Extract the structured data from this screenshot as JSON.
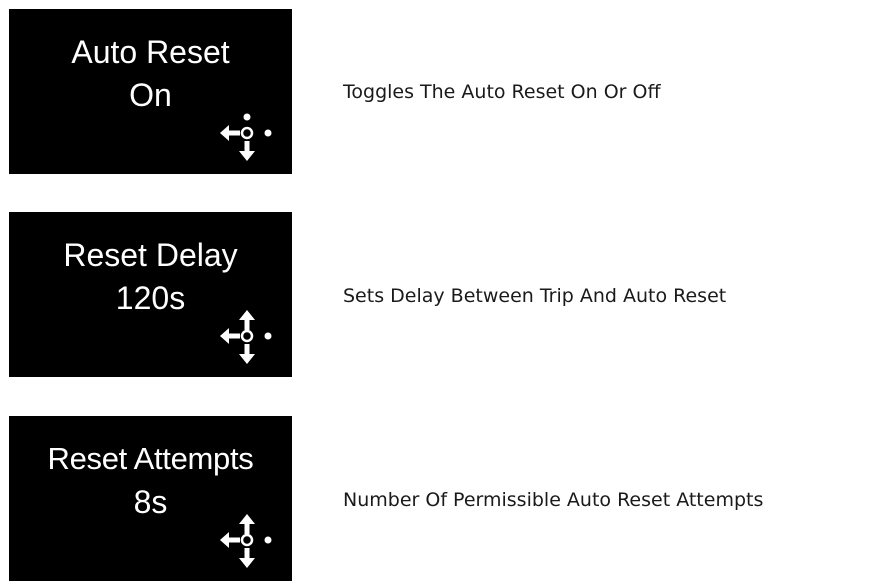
{
  "settings": [
    {
      "title": "Auto Reset",
      "value": "On",
      "description": "Toggles The Auto Reset On Or Off",
      "nav_icon": "nav-left-right-down-icon"
    },
    {
      "title": "Reset Delay",
      "value": "120s",
      "description": "Sets Delay Between Trip And Auto Reset",
      "nav_icon": "nav-four-way-icon"
    },
    {
      "title": "Reset Attempts",
      "value": "8s",
      "description": "Number Of Permissible Auto Reset Attempts",
      "nav_icon": "nav-four-way-icon"
    }
  ],
  "colors": {
    "screen_background": "#000000",
    "screen_text": "#ffffff",
    "description_text": "#1a1a1a"
  }
}
